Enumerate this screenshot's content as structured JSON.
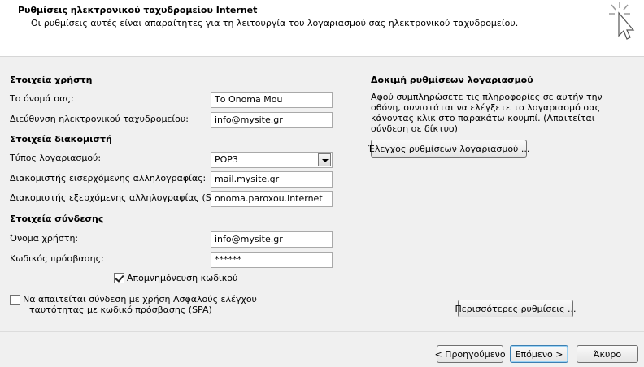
{
  "header": {
    "title": "Ρυθμίσεις ηλεκτρονικού ταχυδρομείου Internet",
    "subtitle": "Οι ρυθμίσεις αυτές είναι απαραίτητες για τη λειτουργία του λογαριασμού σας ηλεκτρονικού ταχυδρομείου.",
    "icon": "cursor-sparkle-icon"
  },
  "user_info": {
    "title": "Στοιχεία χρήστη",
    "name_label": "Το όνομά σας:",
    "name_value": "Το Onoma Mou",
    "email_label": "Διεύθυνση ηλεκτρονικού ταχυδρομείου:",
    "email_value": "info@mysite.gr"
  },
  "server_info": {
    "title": "Στοιχεία διακομιστή",
    "account_type_label": "Τύπος λογαριασμού:",
    "account_type_value": "POP3",
    "incoming_label": "Διακομιστής εισερχόμενης αλληλογραφίας:",
    "incoming_value": "mail.mysite.gr",
    "outgoing_label": "Διακομιστής εξερχόμενης αλληλογραφίας (SMTP):",
    "outgoing_value": "onoma.paroxou.internet"
  },
  "login_info": {
    "title": "Στοιχεία σύνδεσης",
    "username_label": "Όνομα χρήστη:",
    "username_value": "info@mysite.gr",
    "password_label": "Κωδικός πρόσβασης:",
    "password_value": "******",
    "remember_label": "Απομνημόνευση κωδικού",
    "remember_checked": true,
    "spa_label_line1": "Να απαιτείται σύνδεση με χρήση Ασφαλούς ελέγχου",
    "spa_label_line2": "ταυτότητας με κωδικό πρόσβασης (SPA)",
    "spa_checked": false
  },
  "test_settings": {
    "title": "Δοκιμή ρυθμίσεων λογαριασμού",
    "desc_line1": "Αφού συμπληρώσετε τις πληροφορίες σε αυτήν την",
    "desc_line2": "οθόνη, συνιστάται να ελέγξετε το λογαριασμό σας",
    "desc_line3": "κάνοντας κλικ στο παρακάτω κουμπί. (Απαιτείται",
    "desc_line4": "σύνδεση σε δίκτυο)",
    "test_button": "Έλεγχος ρυθμίσεων λογαριασμού ...",
    "more_button": "Περισσότερες ρυθμίσεις ..."
  },
  "footer": {
    "back_button": "< Προηγούμενο",
    "next_button": "Επόμενο >",
    "cancel_button": "Άκυρο"
  }
}
